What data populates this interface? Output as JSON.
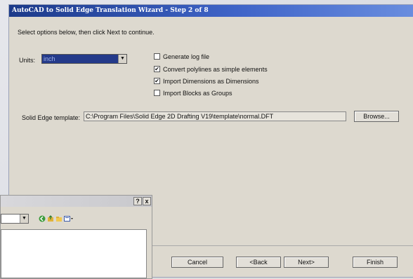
{
  "wizard": {
    "title": "AutoCAD to Solid Edge Translation Wizard - Step 2 of 8",
    "instruction": "Select options below, then click Next to continue.",
    "units": {
      "label": "Units:",
      "value": "inch"
    },
    "options": [
      {
        "label": "Generate log file",
        "checked": false
      },
      {
        "label": "Convert polylines as simple elements",
        "checked": true
      },
      {
        "label": "Import Dimensions as Dimensions",
        "checked": true
      },
      {
        "label": "Import Blocks as Groups",
        "checked": false
      }
    ],
    "template": {
      "label": "Solid Edge template:",
      "value": "C:\\Program Files\\Solid Edge 2D Drafting V19\\template\\normal.DFT",
      "browse_label": "Browse..."
    },
    "buttons": {
      "cancel": "Cancel",
      "back": "<Back",
      "next": "Next>",
      "finish": "Finish"
    }
  },
  "dialog": {
    "help": "?",
    "close": "x",
    "toolbar_icons": [
      "back-icon",
      "up-folder-icon",
      "new-folder-icon",
      "views-menu-icon"
    ]
  }
}
